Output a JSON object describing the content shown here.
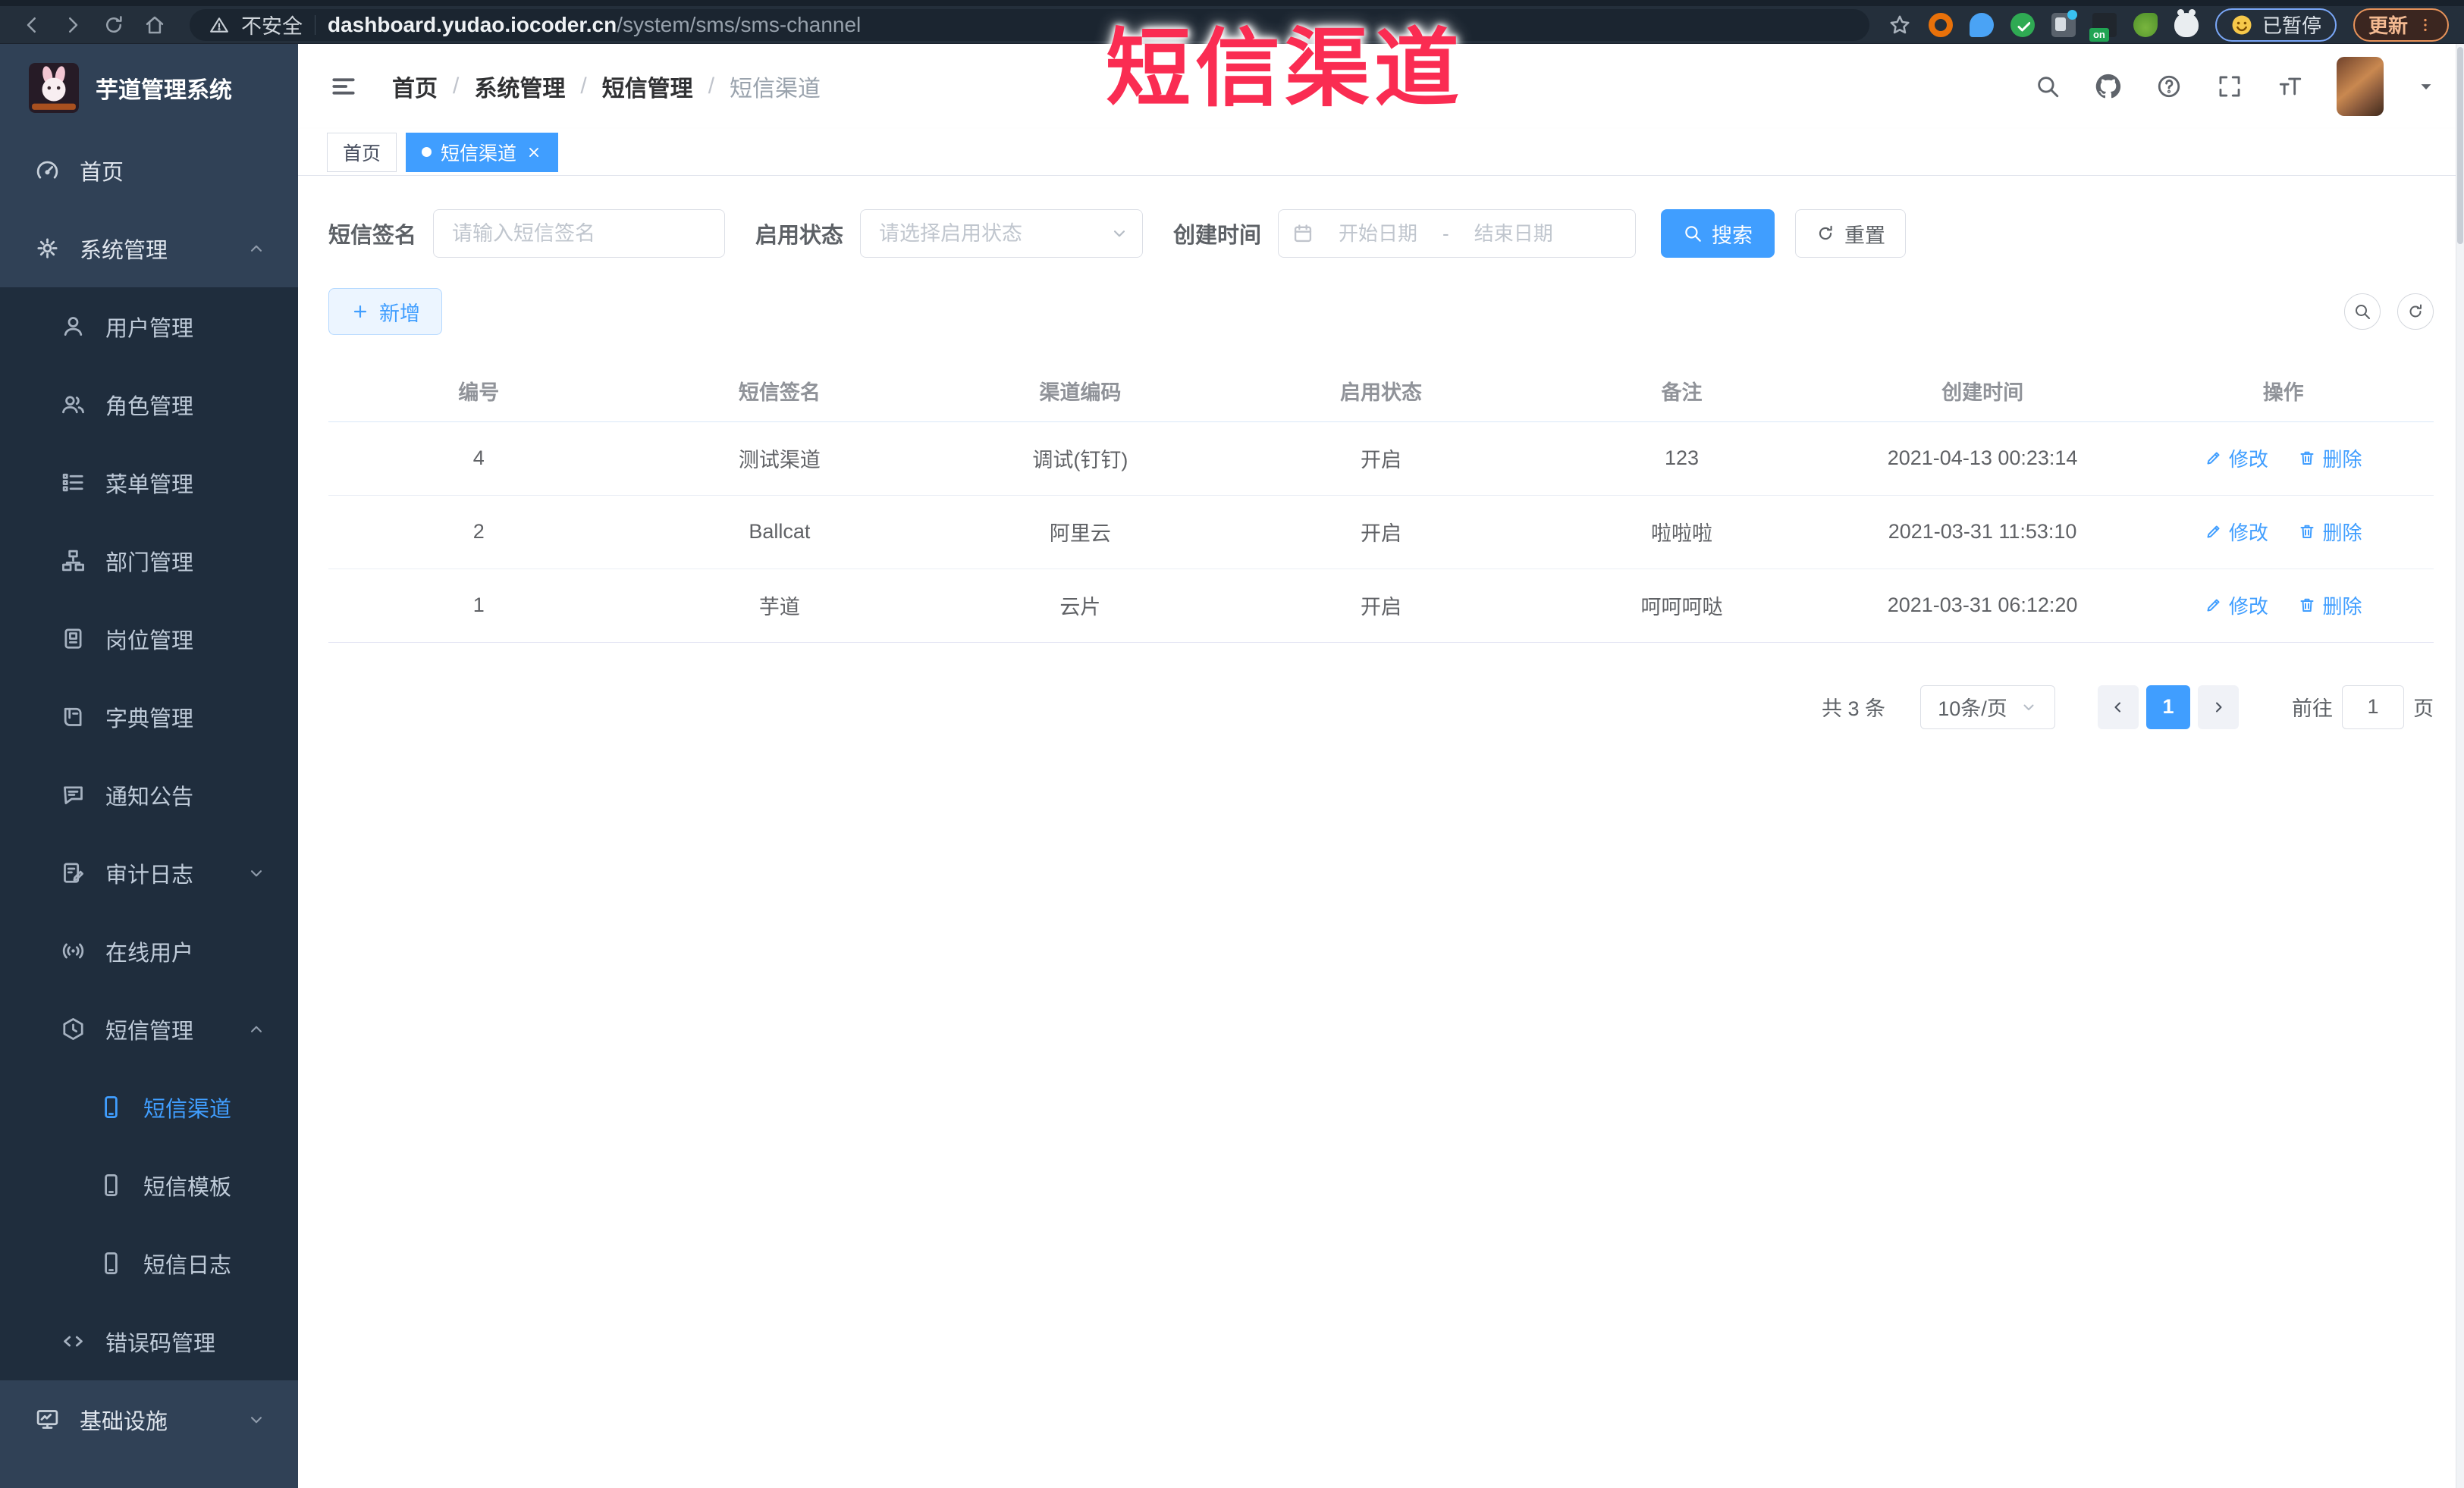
{
  "browser": {
    "security_label": "不安全",
    "url_domain": "dashboard.yudao.iocoder.cn",
    "url_path": "/system/sms/sms-channel",
    "paused_badge_label": "已暂停",
    "update_button_label": "更新",
    "extension_badge": "on"
  },
  "overlay_title": "短信渠道",
  "sidebar": {
    "logo_title": "芋道管理系统",
    "items": [
      {
        "label": "首页"
      },
      {
        "label": "系统管理",
        "expanded": true
      },
      {
        "label": "用户管理"
      },
      {
        "label": "角色管理"
      },
      {
        "label": "菜单管理"
      },
      {
        "label": "部门管理"
      },
      {
        "label": "岗位管理"
      },
      {
        "label": "字典管理"
      },
      {
        "label": "通知公告"
      },
      {
        "label": "审计日志",
        "expanded": false
      },
      {
        "label": "在线用户"
      },
      {
        "label": "短信管理",
        "expanded": true
      },
      {
        "label": "短信渠道",
        "active": true
      },
      {
        "label": "短信模板"
      },
      {
        "label": "短信日志"
      },
      {
        "label": "错误码管理"
      },
      {
        "label": "基础设施",
        "expanded": false
      }
    ]
  },
  "header": {
    "breadcrumb": [
      "首页",
      "系统管理",
      "短信管理",
      "短信渠道"
    ],
    "breadcrumb_separator": "/"
  },
  "tabs": [
    {
      "label": "首页",
      "active": false
    },
    {
      "label": "短信渠道",
      "active": true
    }
  ],
  "filters": {
    "sign_label": "短信签名",
    "sign_placeholder": "请输入短信签名",
    "status_label": "启用状态",
    "status_placeholder": "请选择启用状态",
    "date_label": "创建时间",
    "date_start_placeholder": "开始日期",
    "date_separator": "-",
    "date_end_placeholder": "结束日期",
    "search_label": "搜索",
    "reset_label": "重置"
  },
  "toolbar": {
    "add_label": "新增"
  },
  "table": {
    "headers": [
      "编号",
      "短信签名",
      "渠道编码",
      "启用状态",
      "备注",
      "创建时间",
      "操作"
    ],
    "rows": [
      {
        "id": "4",
        "sign": "测试渠道",
        "code": "调试(钉钉)",
        "status": "开启",
        "remark": "123",
        "created": "2021-04-13 00:23:14"
      },
      {
        "id": "2",
        "sign": "Ballcat",
        "code": "阿里云",
        "status": "开启",
        "remark": "啦啦啦",
        "created": "2021-03-31 11:53:10"
      },
      {
        "id": "1",
        "sign": "芋道",
        "code": "云片",
        "status": "开启",
        "remark": "呵呵呵哒",
        "created": "2021-03-31 06:12:20"
      }
    ],
    "edit_label": "修改",
    "delete_label": "删除"
  },
  "pagination": {
    "total_text": "共 3 条",
    "page_size": "10条/页",
    "current_page": "1",
    "goto_label": "前往",
    "goto_value": "1",
    "page_unit": "页"
  },
  "colors": {
    "accent": "#409eff",
    "sidebar_bg": "#304156",
    "submenu_bg": "#1f2d3d",
    "overlay_red": "#fa2c52"
  },
  "icons": {
    "browser": [
      "back-icon",
      "forward-icon",
      "reload-icon",
      "home-icon",
      "warning-icon",
      "star-icon",
      "extensions",
      "more-menu-icon"
    ],
    "header": [
      "hamburger-icon",
      "search-icon",
      "github-icon",
      "question-icon",
      "fullscreen-icon",
      "font-size-icon",
      "caret-down-icon"
    ],
    "sidebar": [
      "dashboard-icon",
      "gear-icon",
      "user-icon",
      "users-icon",
      "menu-list-icon",
      "org-tree-icon",
      "post-icon",
      "dict-book-icon",
      "notice-icon",
      "audit-log-icon",
      "online-icon",
      "sms-icon",
      "phone-icon",
      "code-icon",
      "infra-monitor-icon"
    ],
    "content": [
      "calendar-icon",
      "magnifier-icon",
      "refresh-icon",
      "plus-icon",
      "edit-icon",
      "trash-icon",
      "chevron-icons",
      "arrow-icons"
    ]
  }
}
